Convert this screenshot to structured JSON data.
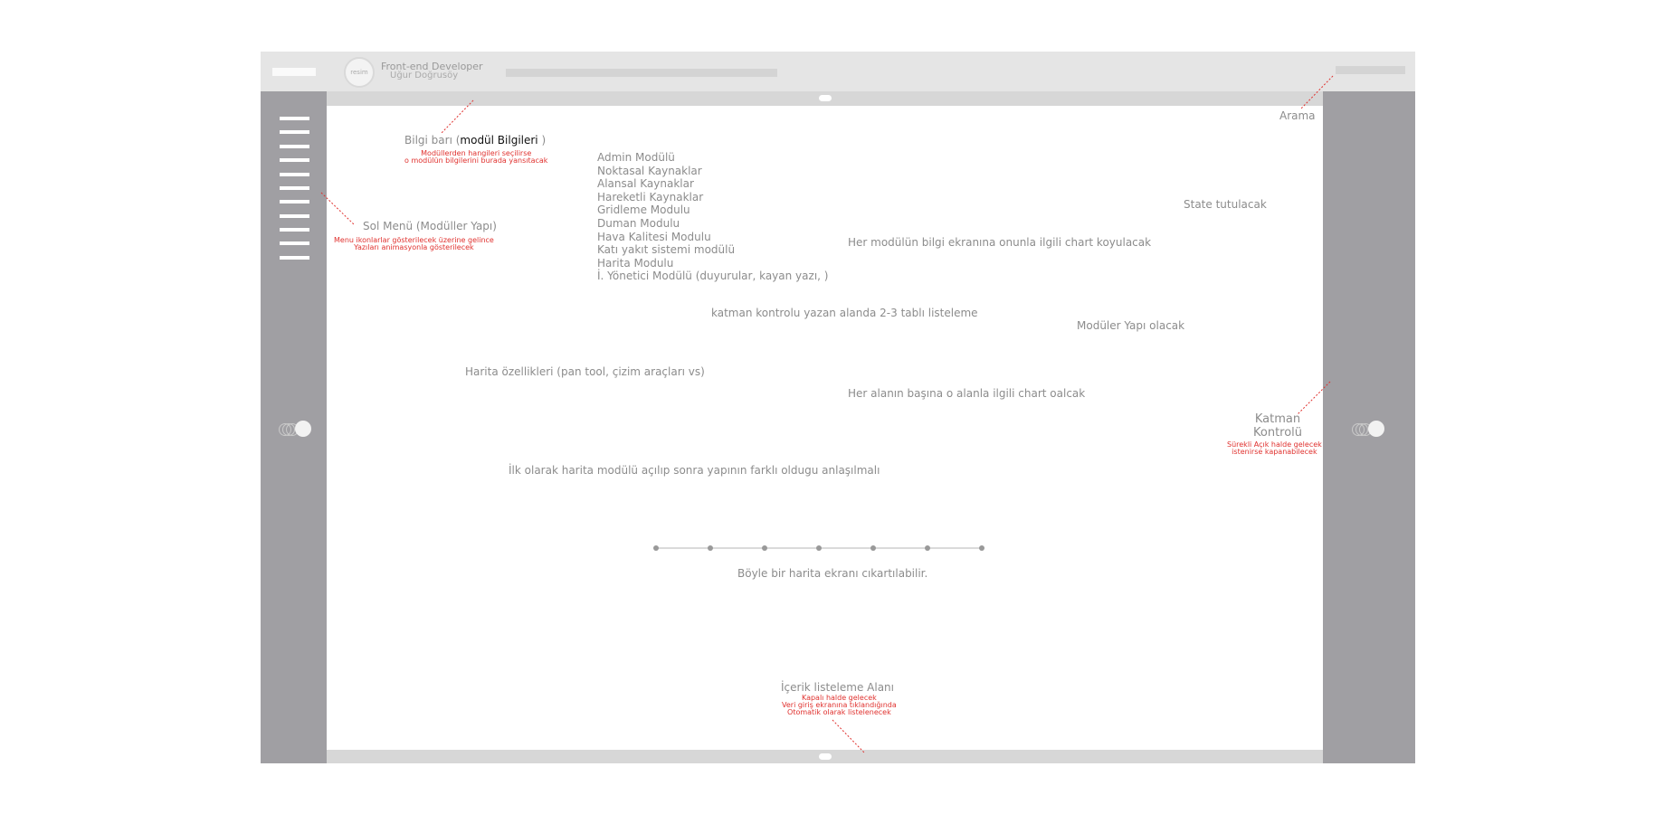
{
  "header": {
    "avatar_text": "resim",
    "user_title": "Front-end Developer",
    "user_name": "Uğur Doğrusöy"
  },
  "annotations": {
    "bilgi_bari_prefix": "Bilgi barı (",
    "bilgi_bari_bold": "modül Bilgileri",
    "bilgi_bari_suffix": " )",
    "bilgi_bari_red_1": "Modüllerden hangileri seçilirse",
    "bilgi_bari_red_2": "o modülün bilgilerini burada yansıtacak",
    "sol_menu": "Sol Menü (Modüller Yapı)",
    "sol_menu_red_1": "Menu ikonlarlar gösterilecek üzerine gelince",
    "sol_menu_red_2": "Yazıları animasyonla gösterilecek",
    "arama": "Arama",
    "state": "State tutulacak",
    "chart_info": "Her modülün bilgi ekranına onunla ilgili chart koyulacak",
    "katman_list": "katman kontrolu yazan alanda 2-3 tablı listeleme",
    "moduler_yapi": "Modüler Yapı olacak",
    "harita_ozellik": "Harita özellikleri (pan tool, çizim araçları vs)",
    "alan_chart": "Her alanın başına o alanla ilgili chart oalcak",
    "katman_1": "Katman",
    "katman_2": "Kontrolü",
    "katman_red_1": "Sürekli Açık halde gelecek",
    "katman_red_2": "istenirse kapanabilecek",
    "ilk_olarak": "İlk olarak harita modülü açılıp sonra yapının farklı oldugu anlaşılmalı",
    "boyle": "Böyle bir harita ekranı cıkartılabilir.",
    "icerik": "İçerik listeleme Alanı",
    "icerik_red_1": "Kapalı halde gelecek",
    "icerik_red_2": "Veri giriş ekranına tıklandığında",
    "icerik_red_3": "Otomatik olarak listelenecek"
  },
  "modules": [
    "Admin Modülü",
    "Noktasal Kaynaklar",
    "Alansal Kaynaklar",
    "Hareketli Kaynaklar",
    "Gridleme Modulu",
    "Duman Modulu",
    "Hava Kalitesi Modulu",
    "Katı yakıt sistemi modülü",
    "Harita Modulu",
    "İ. Yönetici Modülü (duyurular, kayan yazı, )"
  ],
  "colors": {
    "sidebar": "#a09fa3",
    "topbar": "#e5e5e5",
    "annotation_red": "#e0312e"
  }
}
